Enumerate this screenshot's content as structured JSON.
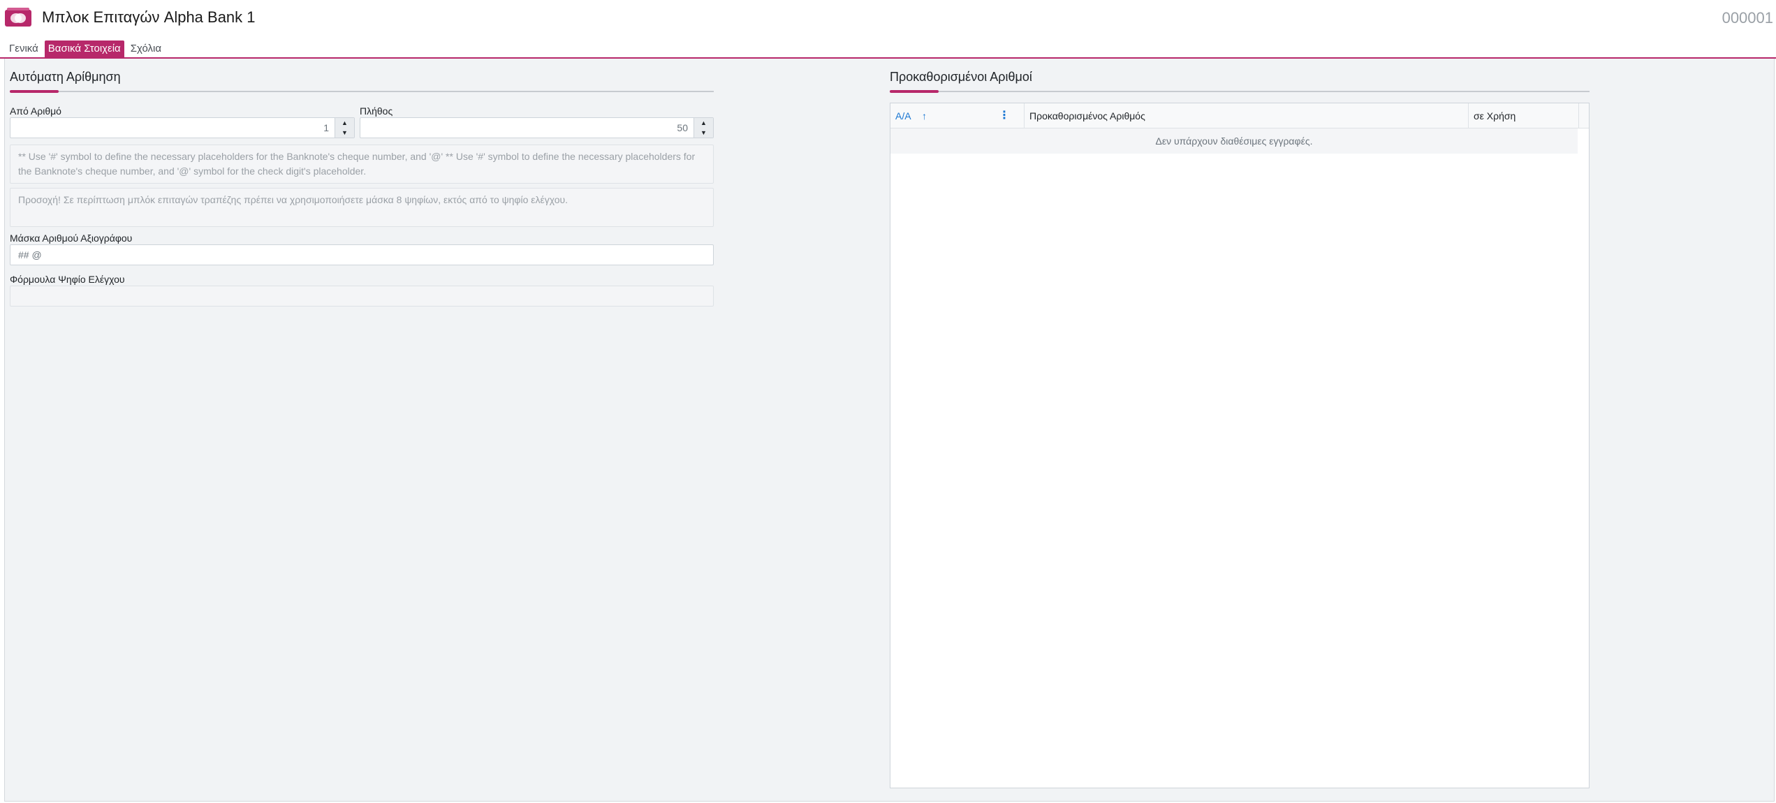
{
  "header": {
    "title": "Μπλοκ Επιταγών Alpha Bank 1",
    "record_no": "000001",
    "logo_icon": "cheque-book-icon"
  },
  "tabs": [
    {
      "label": "Γενικά",
      "active": false
    },
    {
      "label": "Βασικά Στοιχεία",
      "active": true
    },
    {
      "label": "Σχόλια",
      "active": false
    }
  ],
  "auto_numbering": {
    "title": "Αυτόματη Αρίθμηση",
    "from_label": "Από Αριθμό",
    "from_value": "1",
    "count_label": "Πλήθος",
    "count_value": "50",
    "note1": "** Use '#' symbol to define the necessary placeholders for the Banknote's cheque number, and '@' ** Use '#' symbol to define the necessary placeholders for the Banknote's cheque number, and '@' symbol for the check digit's placeholder.",
    "note2": "Προσοχή! Σε περίπτωση μπλόκ επιταγών τραπέζης πρέπει να χρησιμοποιήσετε μάσκα 8 ψηφίων, εκτός από το ψηφίο ελέγχου.",
    "mask_label": "Μάσκα Αριθμού Αξιογράφου",
    "mask_value": "## @",
    "formula_label": "Φόρμουλα Ψηφίο Ελέγχου",
    "formula_value": ""
  },
  "predefined": {
    "title": "Προκαθορισμένοι Αριθμοί",
    "columns": [
      "A/A",
      "Προκαθορισμένος Αριθμός",
      "σε Χρήση"
    ],
    "empty_text": "Δεν υπάρχουν διαθέσιμες εγγραφές."
  },
  "colors": {
    "accent": "#b7286a",
    "link": "#1976d2"
  }
}
